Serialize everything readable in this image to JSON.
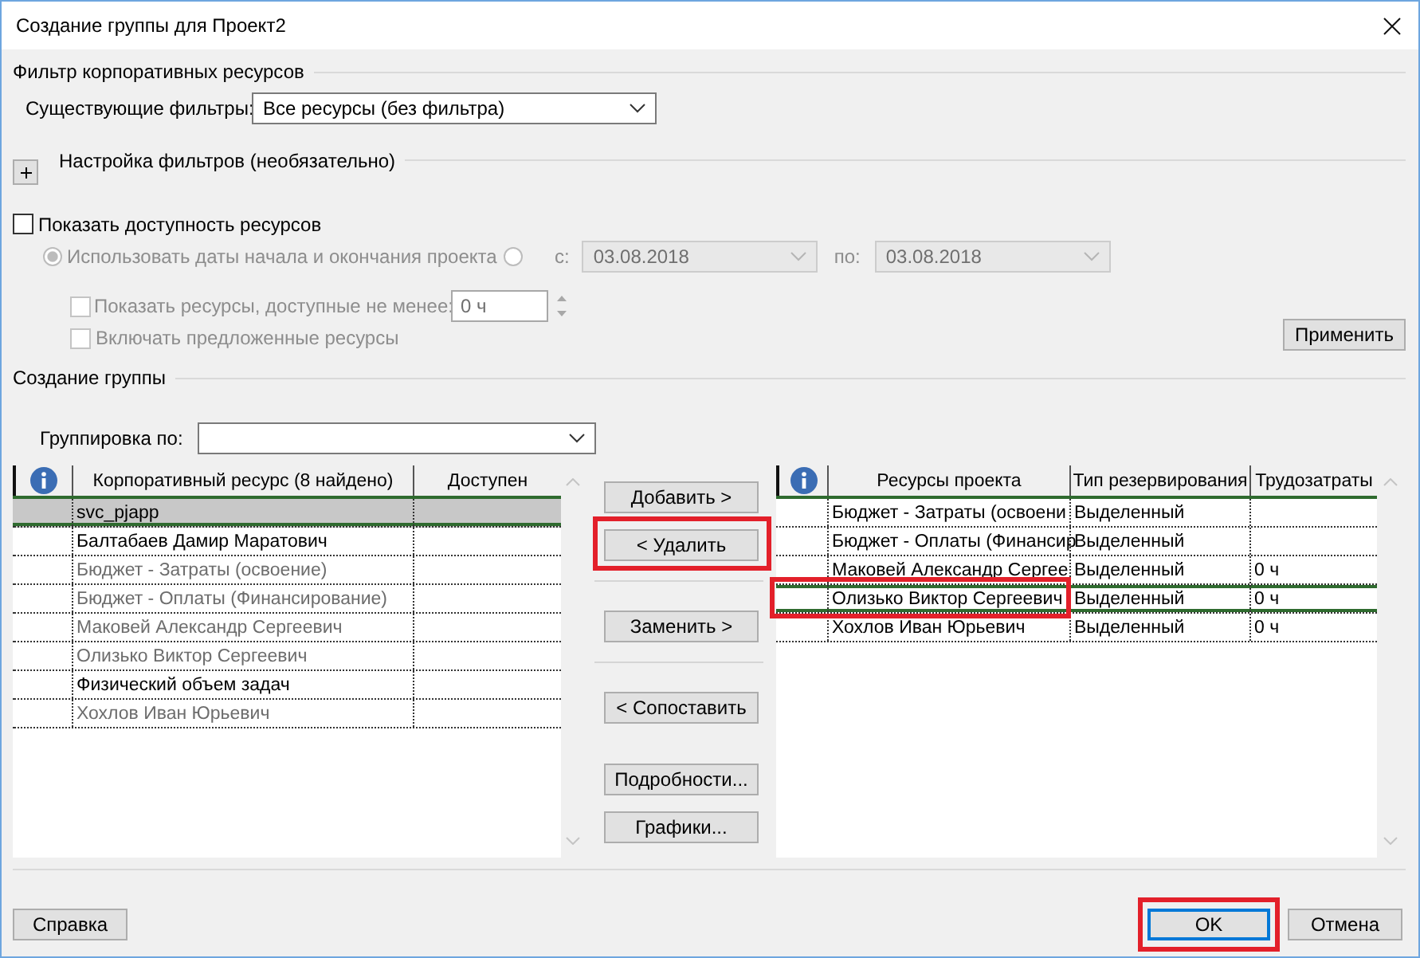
{
  "window": {
    "title": "Создание группы для Проект2"
  },
  "filter_section": {
    "title": "Фильтр корпоративных ресурсов",
    "existing_filters": {
      "label": "Существующие фильтры:",
      "value": "Все ресурсы (без фильтра)"
    },
    "custom_filters": {
      "title": "Настройка фильтров (необязательно)",
      "expanded": false
    }
  },
  "availability": {
    "show": {
      "label": "Показать доступность ресурсов",
      "checked": false
    },
    "disabled": true,
    "range_options": [
      {
        "label": "Использовать даты начала и окончания проекта",
        "selected": true
      },
      {
        "selected": false,
        "from": {
          "label": "с:",
          "value": "03.08.2018"
        },
        "to": {
          "label": "по:",
          "value": "03.08.2018"
        }
      }
    ],
    "min_available": {
      "label": "Показать ресурсы, доступные не менее:",
      "checked": false,
      "value": "0 ч"
    },
    "include_proposed": {
      "label": "Включать предложенные ресурсы",
      "checked": false
    },
    "apply_button": "Применить"
  },
  "group_section": {
    "title": "Создание группы",
    "group_by": {
      "label": "Группировка по:"
    }
  },
  "enterprise_table": {
    "columns": [
      {
        "kind": "info"
      },
      {
        "kind": "text",
        "label": "Корпоративный ресурс (8 найдено)"
      },
      {
        "kind": "text",
        "label": "Доступен"
      }
    ],
    "rows": [
      {
        "name": "svc_pjapp",
        "in_project": false,
        "selected": true
      },
      {
        "name": "Балтабаев Дамир Маратович",
        "in_project": false,
        "selected": false
      },
      {
        "name": "Бюджет - Затраты (освоение)",
        "in_project": true,
        "selected": false
      },
      {
        "name": "Бюджет - Оплаты (Финансирование)",
        "in_project": true,
        "selected": false
      },
      {
        "name": "Маковей Александр Сергеевич",
        "in_project": true,
        "selected": false
      },
      {
        "name": "Олизько Виктор Сергеевич",
        "in_project": true,
        "selected": false
      },
      {
        "name": "Физический объем задач",
        "in_project": false,
        "selected": false
      },
      {
        "name": "Хохлов Иван Юрьевич",
        "in_project": true,
        "selected": false
      }
    ]
  },
  "middle_button_groups": [
    {
      "buttons": [
        {
          "label": "Добавить >",
          "highlighted": false
        },
        {
          "label": "< Удалить",
          "highlighted": true
        }
      ],
      "separator": true
    },
    {
      "buttons": [
        {
          "label": "Заменить >",
          "highlighted": false
        }
      ],
      "separator": true
    },
    {
      "buttons": [
        {
          "label": "< Сопоставить",
          "highlighted": false
        }
      ],
      "separator": false
    },
    {
      "buttons": [
        {
          "label": "Подробности...",
          "highlighted": false
        },
        {
          "label": "Графики...",
          "highlighted": false
        }
      ]
    }
  ],
  "project_table": {
    "columns": [
      {
        "kind": "info"
      },
      {
        "kind": "text",
        "label": "Ресурсы проекта"
      },
      {
        "kind": "text",
        "label": "Тип резервирования"
      },
      {
        "kind": "text",
        "label": "Трудозатраты"
      }
    ],
    "rows": [
      {
        "name": "Бюджет - Затраты (освоени",
        "booking": "Выделенный",
        "selected": false,
        "highlighted": false
      },
      {
        "name": "Бюджет - Оплаты (Финансир",
        "booking": "Выделенный",
        "selected": false,
        "highlighted": false
      },
      {
        "name": "Маковей Александр Сергее",
        "booking": "Выделенный",
        "work": "0 ч",
        "selected": false,
        "highlighted": false
      },
      {
        "name": "Олизько Виктор Сергеевич",
        "booking": "Выделенный",
        "work": "0 ч",
        "selected": true,
        "highlighted": true
      },
      {
        "name": "Хохлов Иван Юрьевич",
        "booking": "Выделенный",
        "work": "0 ч",
        "selected": false,
        "highlighted": false
      }
    ]
  },
  "footer": {
    "help": {
      "label": "Справка"
    },
    "ok": {
      "label": "OK",
      "default": true,
      "highlighted": true
    },
    "cancel": {
      "label": "Отмена"
    }
  }
}
